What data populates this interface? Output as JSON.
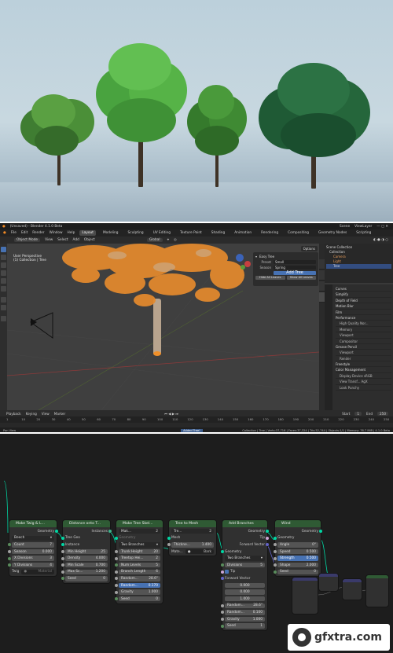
{
  "titlebar": {
    "title": "(Unsaved) - Blender 4.1.0 Beta",
    "scene": "Scene",
    "view_layer": "ViewLayer"
  },
  "menu": [
    "File",
    "Edit",
    "Render",
    "Window",
    "Help"
  ],
  "workspaces": [
    "Layout",
    "Modeling",
    "Sculpting",
    "UV Editing",
    "Texture Paint",
    "Shading",
    "Animation",
    "Rendering",
    "Compositing",
    "Geometry Nodes",
    "Scripting"
  ],
  "viewport_header": {
    "mode": "Object Mode",
    "items": [
      "View",
      "Select",
      "Add",
      "Object"
    ],
    "orientation": "Global"
  },
  "viewport": {
    "line1": "User Perspective",
    "line2": "(1) Collection | Tree",
    "options": "Options"
  },
  "easy_tree": {
    "title": "Easy Tree",
    "preset_label": "Preset",
    "preset_value": "Small",
    "season_label": "Season",
    "season_value": "Spring",
    "add_tree": "Add Tree",
    "hide_leaves": "Hide All Leaves",
    "show_leaves": "Show All Leaves"
  },
  "outliner": [
    "Scene Collection",
    "Collection",
    "Camera",
    "Light",
    "Tree"
  ],
  "properties": {
    "rows": [
      {
        "label": "Curves",
        "sub": false
      },
      {
        "label": "Simplify",
        "sub": false
      },
      {
        "label": "Depth of Field",
        "sub": false
      },
      {
        "label": "Motion Blur",
        "sub": false
      },
      {
        "label": "Film",
        "sub": false
      },
      {
        "label": "Performance",
        "sub": false
      },
      {
        "label": "High Quality Nor...",
        "sub": true
      },
      {
        "label": "Memory",
        "sub": true
      },
      {
        "label": "Viewport",
        "sub": true
      },
      {
        "label": "Compositor",
        "sub": true
      },
      {
        "label": "Grease Pencil",
        "sub": false
      },
      {
        "label": "Viewport",
        "sub": true
      },
      {
        "label": "Render",
        "sub": true
      },
      {
        "label": "Freestyle",
        "sub": false
      },
      {
        "label": "Color Management",
        "sub": false
      },
      {
        "label": "Display Device    sRGB",
        "sub": true
      },
      {
        "label": "View Transf...    AgX",
        "sub": true
      },
      {
        "label": "Look    Punchy",
        "sub": true
      }
    ]
  },
  "timeline": {
    "items": [
      "Playback",
      "Keying",
      "View",
      "Marker"
    ],
    "start_label": "Start",
    "start": "1",
    "end_label": "End",
    "end": "250",
    "ticks": [
      "1",
      "10",
      "20",
      "30",
      "40",
      "50",
      "60",
      "70",
      "80",
      "90",
      "100",
      "110",
      "120",
      "130",
      "140",
      "150",
      "160",
      "170",
      "180",
      "190",
      "200",
      "210",
      "220",
      "230",
      "240",
      "250"
    ]
  },
  "statusbar": {
    "left": "Pan View",
    "mid": "Added Tree!",
    "right": "Collection | Tree | Verts:37,716 | Faces:37,324 | Tris:52,744 | Objects:1/1 | Memory: 76.7 MiB | 4.1.0 Beta"
  },
  "nodes": {
    "n1": {
      "title": "Make Twig & L...",
      "out": "Geometry",
      "drop": "Beech",
      "fields": [
        [
          "Count",
          "7"
        ],
        [
          "Season",
          "0.000"
        ],
        [
          "X Divisions",
          "3"
        ],
        [
          "Y Divisions",
          "4"
        ]
      ],
      "twig_label": "Twig",
      "twig_value": "Material"
    },
    "n2": {
      "title": "Distance onto T...",
      "out": "Instances",
      "in1": "Tree Geo",
      "in2": "Instance",
      "fields": [
        [
          "Min Height",
          ".25"
        ],
        [
          "Density",
          "4.000"
        ],
        [
          "Min Scale",
          "0.700"
        ],
        [
          "Max Sc...",
          "1.200"
        ],
        [
          "Seed",
          "0"
        ]
      ]
    },
    "n3": {
      "title": "Make Tree Skel...",
      "btn": "Mak...",
      "btn_num": "2",
      "in1": "Geometry",
      "drop": "Two Branches",
      "fields": [
        [
          "Trunk Height",
          ".20"
        ],
        [
          "Treetop Hei...",
          "2"
        ],
        [
          "Num Levels",
          "5"
        ],
        [
          "Branch Length",
          "6"
        ],
        [
          "Random...",
          "28.6°"
        ]
      ],
      "blue_label": "Random...",
      "blue_value": "0.170",
      "fields2": [
        [
          "Gravity",
          "1.000"
        ],
        [
          "Seed",
          "0"
        ]
      ]
    },
    "n4": {
      "title": "Tree to Mesh",
      "btn": "Tre...",
      "btn_num": "2",
      "in1": "Mesh",
      "field_label": "Thickne...",
      "field_value": "1.400",
      "mat_label": "Mate...",
      "mat_value": "Bark"
    },
    "n5": {
      "title": "Add Branches",
      "out": "Geometry",
      "out2": "Tip",
      "out3": "Forward Vector",
      "in1": "Geometry",
      "drop": "Two Branches",
      "div_label": "Divisions",
      "div_value": "5",
      "tip": "Tip",
      "vec_label": "Forward Vector",
      "vec": [
        "0.000",
        "0.000",
        "1.000"
      ],
      "fields": [
        [
          "Random...",
          "28.6°"
        ],
        [
          "Random...",
          "0.100"
        ],
        [
          "Gravity",
          "1.000"
        ],
        [
          "Seed",
          "1"
        ]
      ]
    },
    "n6": {
      "title": "Wind",
      "out": "Geometry",
      "in1": "Geometry",
      "fields": [
        [
          "Angle",
          "0°"
        ],
        [
          "Speed",
          "0.500"
        ]
      ],
      "blue_label": "Strength",
      "blue_value": "0.500",
      "fields2": [
        [
          "Shape",
          "2.000"
        ],
        [
          "Seed",
          "0"
        ]
      ]
    }
  },
  "watermark": {
    "text": "gfxtra.com"
  },
  "colors": {
    "node_header": "#2f5a34",
    "accent_blue": "#4772b3",
    "selection_orange": "#f0902a",
    "geometry_socket": "#00d6a3"
  }
}
